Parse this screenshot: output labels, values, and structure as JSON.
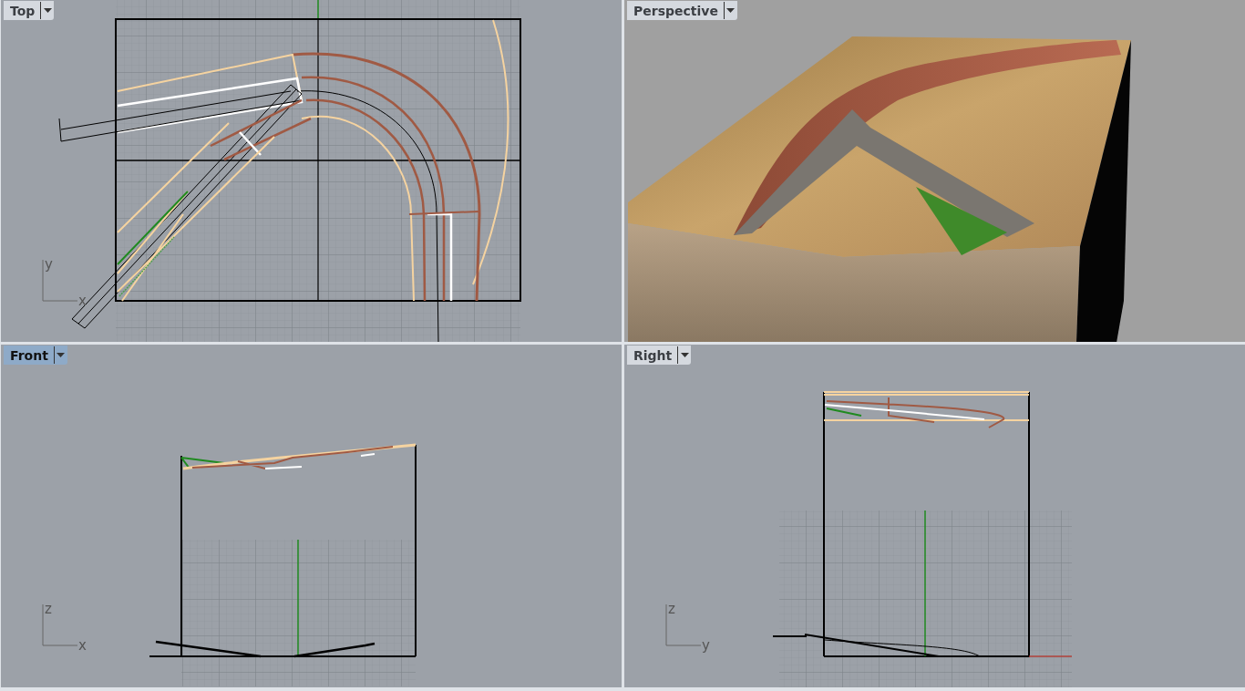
{
  "viewports": [
    {
      "title": "Top",
      "kind": "top",
      "selected": false,
      "axes": {
        "vertical": "y",
        "horizontal": "x"
      }
    },
    {
      "title": "Perspective",
      "kind": "perspective",
      "selected": false
    },
    {
      "title": "Front",
      "kind": "front",
      "selected": true,
      "axes": {
        "vertical": "z",
        "horizontal": "x"
      }
    },
    {
      "title": "Right",
      "kind": "right",
      "selected": false,
      "axes": {
        "vertical": "z",
        "horizontal": "y"
      }
    }
  ]
}
